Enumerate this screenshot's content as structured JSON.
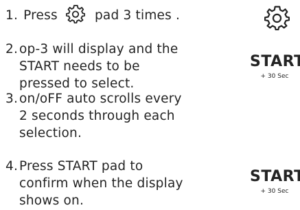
{
  "steps": [
    {
      "num": "1.",
      "text_before": "Press",
      "icon": "gear-icon",
      "text_after": "pad 3 times ."
    },
    {
      "num": "2.",
      "lines": [
        "op-3 will display and the",
        "STAR"
      ]
    }
  ]
}
